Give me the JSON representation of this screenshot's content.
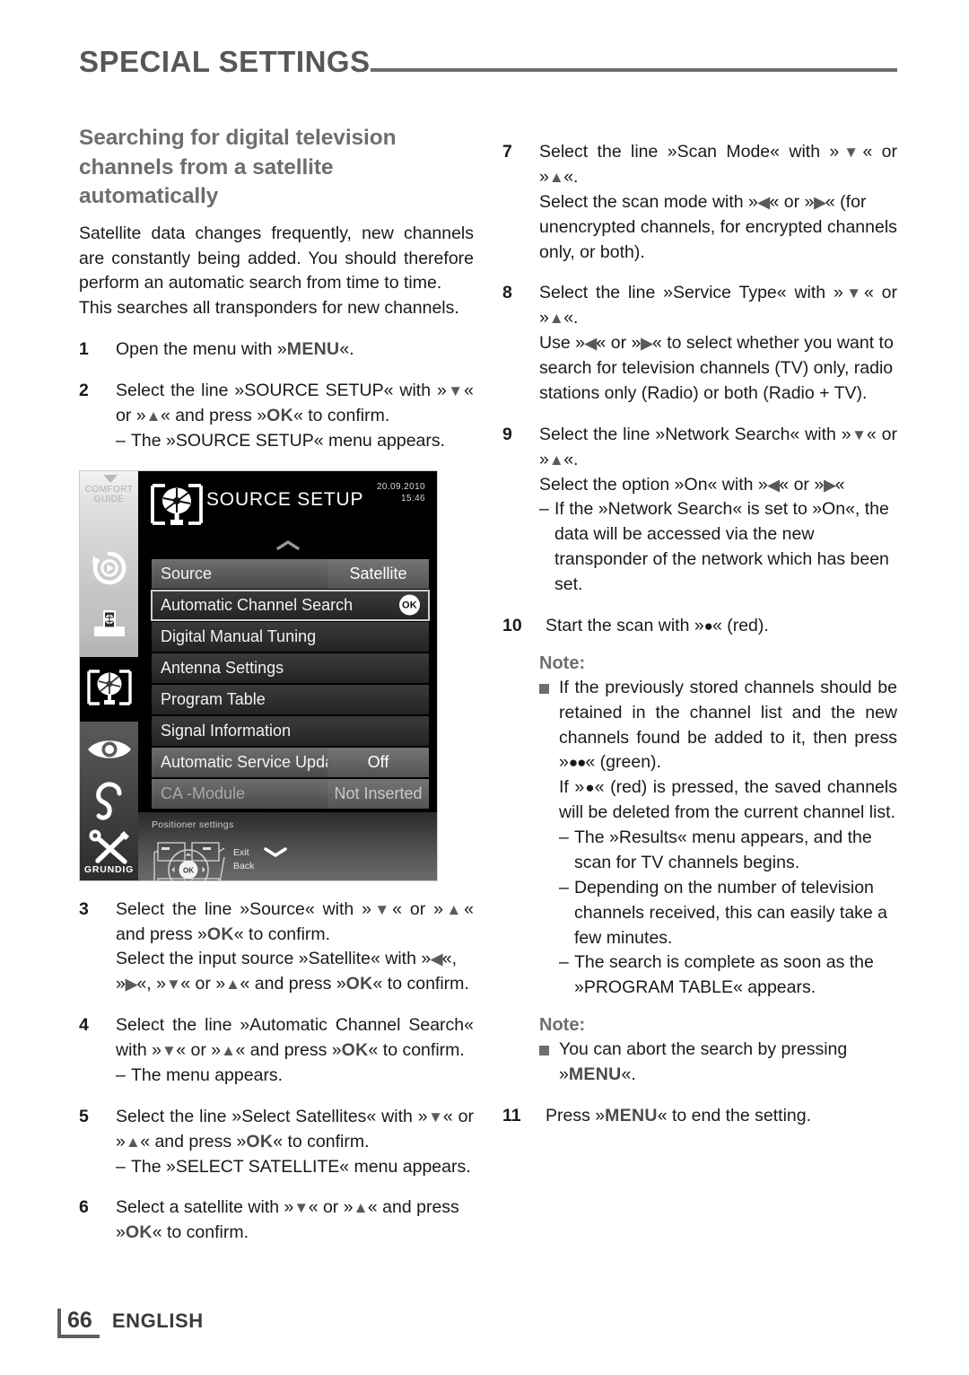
{
  "header": {
    "chapter_title": "SPECIAL SETTINGS"
  },
  "left_column": {
    "section_title": "Searching for digital television channels from a satellite automatically",
    "intro_paragraph": "Satellite data changes frequently, new channels are constantly being added. You should therefore perform an automatic search from time to time.",
    "intro_paragraph_2": "This searches all transponders for new channels.",
    "steps": [
      {
        "num": "1",
        "lines": [
          {
            "type": "plain",
            "parts": [
              {
                "t": "text",
                "v": "Open the menu with »"
              },
              {
                "t": "kbd",
                "v": "MENU"
              },
              {
                "t": "text",
                "v": "«."
              }
            ]
          }
        ]
      },
      {
        "num": "2",
        "lines": [
          {
            "type": "plain",
            "parts": [
              {
                "t": "text",
                "v": "Select the line »SOURCE SETUP« with »"
              },
              {
                "t": "arrow",
                "v": "▼"
              },
              {
                "t": "text",
                "v": "« or »"
              },
              {
                "t": "arrow",
                "v": "▲"
              },
              {
                "t": "text",
                "v": "« and press »"
              },
              {
                "t": "kbd",
                "v": "OK"
              },
              {
                "t": "text",
                "v": "« to confirm."
              }
            ]
          },
          {
            "type": "sub",
            "parts": [
              {
                "t": "text",
                "v": "The »SOURCE SETUP« menu appears."
              }
            ]
          }
        ]
      },
      {
        "num": "3",
        "lines": [
          {
            "type": "plain",
            "parts": [
              {
                "t": "text",
                "v": "Select the line »Source« with »"
              },
              {
                "t": "arrow",
                "v": "▼"
              },
              {
                "t": "text",
                "v": "« or »"
              },
              {
                "t": "arrow",
                "v": "▲"
              },
              {
                "t": "text",
                "v": "« and press »"
              },
              {
                "t": "kbd",
                "v": "OK"
              },
              {
                "t": "text",
                "v": "« to confirm."
              }
            ]
          },
          {
            "type": "plain",
            "parts": [
              {
                "t": "text",
                "v": "Select the input source »Satellite« with »"
              },
              {
                "t": "arrow",
                "v": "◀"
              },
              {
                "t": "text",
                "v": "«, »"
              },
              {
                "t": "arrow",
                "v": "▶"
              },
              {
                "t": "text",
                "v": "«, »"
              },
              {
                "t": "arrow",
                "v": "▼"
              },
              {
                "t": "text",
                "v": "« or »"
              },
              {
                "t": "arrow",
                "v": "▲"
              },
              {
                "t": "text",
                "v": "« and press »"
              },
              {
                "t": "kbd",
                "v": "OK"
              },
              {
                "t": "text",
                "v": "« to confirm."
              }
            ]
          }
        ]
      },
      {
        "num": "4",
        "lines": [
          {
            "type": "plain",
            "parts": [
              {
                "t": "text",
                "v": "Select the line »Automatic Channel Search« with »"
              },
              {
                "t": "arrow",
                "v": "▼"
              },
              {
                "t": "text",
                "v": "« or »"
              },
              {
                "t": "arrow",
                "v": "▲"
              },
              {
                "t": "text",
                "v": "« and press »"
              },
              {
                "t": "kbd",
                "v": "OK"
              },
              {
                "t": "text",
                "v": "« to confirm."
              }
            ]
          },
          {
            "type": "sub",
            "parts": [
              {
                "t": "text",
                "v": "The menu appears."
              }
            ]
          }
        ]
      },
      {
        "num": "5",
        "lines": [
          {
            "type": "plain",
            "parts": [
              {
                "t": "text",
                "v": "Select the line »Select Satellites« with »"
              },
              {
                "t": "arrow",
                "v": "▼"
              },
              {
                "t": "text",
                "v": "« or »"
              },
              {
                "t": "arrow",
                "v": "▲"
              },
              {
                "t": "text",
                "v": "« and press »"
              },
              {
                "t": "kbd",
                "v": "OK"
              },
              {
                "t": "text",
                "v": "« to confirm."
              }
            ]
          },
          {
            "type": "sub",
            "parts": [
              {
                "t": "text",
                "v": "The »SELECT SATELLITE« menu appears."
              }
            ]
          }
        ]
      },
      {
        "num": "6",
        "lines": [
          {
            "type": "plain",
            "parts": [
              {
                "t": "text",
                "v": "Select a satellite with »"
              },
              {
                "t": "arrow",
                "v": "▼"
              },
              {
                "t": "text",
                "v": "« or »"
              },
              {
                "t": "arrow",
                "v": "▲"
              },
              {
                "t": "text",
                "v": "« and press »"
              },
              {
                "t": "kbd",
                "v": "OK"
              },
              {
                "t": "text",
                "v": "« to confirm."
              }
            ]
          }
        ]
      }
    ]
  },
  "right_column": {
    "steps": [
      {
        "num": "7",
        "lines": [
          {
            "type": "plain",
            "parts": [
              {
                "t": "text",
                "v": "Select the line »Scan Mode« with »"
              },
              {
                "t": "arrow",
                "v": "▼"
              },
              {
                "t": "text",
                "v": "« or »"
              },
              {
                "t": "arrow",
                "v": "▲"
              },
              {
                "t": "text",
                "v": "«."
              }
            ]
          },
          {
            "type": "plain",
            "parts": [
              {
                "t": "text",
                "v": "Select the scan mode with »"
              },
              {
                "t": "arrow",
                "v": "◀"
              },
              {
                "t": "text",
                "v": "« or »"
              },
              {
                "t": "arrow",
                "v": "▶"
              },
              {
                "t": "text",
                "v": "« (for unencrypted channels, for encrypted channels only, or both)."
              }
            ]
          }
        ]
      },
      {
        "num": "8",
        "lines": [
          {
            "type": "plain",
            "parts": [
              {
                "t": "text",
                "v": "Select the line »Service Type« with »"
              },
              {
                "t": "arrow",
                "v": "▼"
              },
              {
                "t": "text",
                "v": "« or »"
              },
              {
                "t": "arrow",
                "v": "▲"
              },
              {
                "t": "text",
                "v": "«."
              }
            ]
          },
          {
            "type": "plain",
            "parts": [
              {
                "t": "text",
                "v": "Use »"
              },
              {
                "t": "arrow",
                "v": "◀"
              },
              {
                "t": "text",
                "v": "« or »"
              },
              {
                "t": "arrow",
                "v": "▶"
              },
              {
                "t": "text",
                "v": "« to select whether you want to search for television channels (TV) only, radio stations only (Radio) or both (Radio + TV)."
              }
            ]
          }
        ]
      },
      {
        "num": "9",
        "lines": [
          {
            "type": "plain",
            "parts": [
              {
                "t": "text",
                "v": "Select the line »Network Search« with »"
              },
              {
                "t": "arrow",
                "v": "▼"
              },
              {
                "t": "text",
                "v": "« or »"
              },
              {
                "t": "arrow",
                "v": "▲"
              },
              {
                "t": "text",
                "v": "«."
              }
            ]
          },
          {
            "type": "plain",
            "parts": [
              {
                "t": "text",
                "v": "Select the option »On« with »"
              },
              {
                "t": "arrow",
                "v": "◀"
              },
              {
                "t": "text",
                "v": "« or »"
              },
              {
                "t": "arrow",
                "v": "▶"
              },
              {
                "t": "text",
                "v": "«"
              }
            ]
          },
          {
            "type": "sub",
            "parts": [
              {
                "t": "text",
                "v": "If the »Network Search« is set to »On«, the data will be accessed via the new transponder of the network which has been set."
              }
            ]
          }
        ]
      },
      {
        "num": "10",
        "wide": true,
        "lines": [
          {
            "type": "plain",
            "parts": [
              {
                "t": "text",
                "v": "Start the scan with »"
              },
              {
                "t": "dot",
                "v": "●"
              },
              {
                "t": "text",
                "v": "« (red)."
              }
            ]
          }
        ]
      }
    ],
    "note_1": {
      "heading": "Note:",
      "lines": [
        {
          "type": "plain",
          "parts": [
            {
              "t": "text",
              "v": "If the previously stored channels should be retained in the channel list and the new channels found be added to it, then press »"
            },
            {
              "t": "dot",
              "v": "●●"
            },
            {
              "t": "text",
              "v": "« (green)."
            }
          ]
        },
        {
          "type": "plain",
          "parts": [
            {
              "t": "text",
              "v": "If »"
            },
            {
              "t": "dot",
              "v": "●"
            },
            {
              "t": "text",
              "v": "« (red) is pressed, the saved channels will be deleted from the current channel list."
            }
          ]
        },
        {
          "type": "sub",
          "parts": [
            {
              "t": "text",
              "v": "The »Results« menu appears, and the scan for TV channels begins."
            }
          ]
        },
        {
          "type": "sub",
          "parts": [
            {
              "t": "text",
              "v": "Depending on the number of television channels received, this can easily take a few minutes."
            }
          ]
        },
        {
          "type": "sub",
          "parts": [
            {
              "t": "text",
              "v": "The search is complete as soon as the »PROGRAM TABLE« appears."
            }
          ]
        }
      ]
    },
    "note_2": {
      "heading": "Note:",
      "lines": [
        {
          "type": "plain",
          "parts": [
            {
              "t": "text",
              "v": "You can abort the search by pressing »"
            },
            {
              "t": "kbd",
              "v": "MENU"
            },
            {
              "t": "text",
              "v": "«."
            }
          ]
        }
      ]
    },
    "final_step": {
      "num": "11",
      "wide": true,
      "lines": [
        {
          "type": "plain",
          "parts": [
            {
              "t": "text",
              "v": "Press »"
            },
            {
              "t": "kbd",
              "v": "MENU"
            },
            {
              "t": "text",
              "v": "« to end the setting."
            }
          ]
        }
      ]
    }
  },
  "osd": {
    "title": "SOURCE SETUP",
    "date": "20.09.2010",
    "time": "15:46",
    "rail": {
      "comfort_label": "COMFORT\nGUIDE",
      "brand": "GRUNDIG",
      "icons": [
        "replay-icon",
        "source-input-icon",
        "satellite-dish-icon",
        "eye-icon",
        "ear-icon",
        "tools-icon"
      ]
    },
    "rows": [
      {
        "label": "Source",
        "value": "Satellite",
        "selected": false,
        "value_lit": true,
        "dim": false,
        "ok": false
      },
      {
        "label": "Automatic Channel Search",
        "value": null,
        "selected": true,
        "value_lit": false,
        "dim": false,
        "ok": true,
        "ok_label": "OK"
      },
      {
        "label": "Digital Manual Tuning",
        "value": null,
        "selected": false,
        "value_lit": false,
        "dim": false,
        "ok": false
      },
      {
        "label": "Antenna Settings",
        "value": null,
        "selected": false,
        "value_lit": false,
        "dim": false,
        "ok": false
      },
      {
        "label": "Program Table",
        "value": null,
        "selected": false,
        "value_lit": false,
        "dim": false,
        "ok": false
      },
      {
        "label": "Signal Information",
        "value": null,
        "selected": false,
        "value_lit": false,
        "dim": false,
        "ok": false
      },
      {
        "label": "Automatic Service Update",
        "value": "Off",
        "selected": false,
        "value_lit": true,
        "dim": false,
        "ok": false
      },
      {
        "label": "CA -Module",
        "value": "Not Inserted",
        "selected": false,
        "value_lit": true,
        "dim": true,
        "ok": false
      }
    ],
    "footer": {
      "positioner_text": "Positioner settings",
      "exit_label": "Exit",
      "back_label": "Back",
      "ok_label": "OK"
    },
    "scroll_up": "⌃",
    "scroll_down": "⌄"
  },
  "footer": {
    "page_number": "66",
    "language": "ENGLISH"
  }
}
